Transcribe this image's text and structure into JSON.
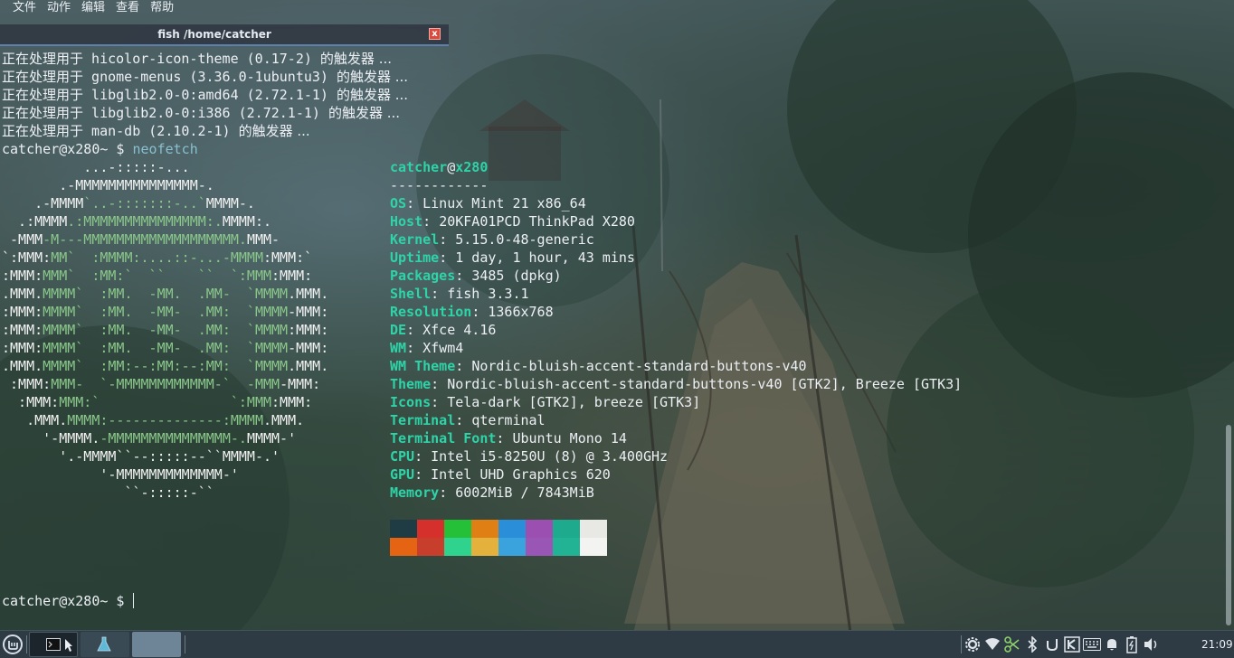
{
  "menubar": {
    "items": [
      "文件",
      "动作",
      "编辑",
      "查看",
      "帮助"
    ]
  },
  "tab": {
    "title": "fish /home/catcher",
    "close_glyph": "x"
  },
  "terminal": {
    "trigger_prefix": "正在处理用于",
    "trigger_suffix": "的触发器 ...",
    "trigger_lines": [
      "hicolor-icon-theme (0.17-2)",
      "gnome-menus (3.36.0-1ubuntu3)",
      "libglib2.0-0:amd64 (2.72.1-1)",
      "libglib2.0-0:i386 (2.72.1-1)",
      "man-db (2.10.2-1)"
    ],
    "prompt": "catcher@x280~ $",
    "command": "neofetch",
    "final_prompt": "catcher@x280~ $"
  },
  "neofetch": {
    "logo": [
      [
        [
          "w",
          "          ...-:::::-..."
        ]
      ],
      [
        [
          "w",
          "       .-MMMMMMMMMMMMMMM-."
        ]
      ],
      [
        [
          "w",
          "    .-MMMM"
        ],
        [
          "g",
          "`..-:::::::-..`"
        ],
        [
          "w",
          "MMMM-."
        ]
      ],
      [
        [
          "w",
          "  .:MMMM"
        ],
        [
          "g",
          ".:MMMMMMMMMMMMMMM:."
        ],
        [
          "w",
          "MMMM:."
        ]
      ],
      [
        [
          "w",
          " -MMM"
        ],
        [
          "g",
          "-M---MMMMMMMMMMMMMMMMMMM."
        ],
        [
          "w",
          "MMM-"
        ]
      ],
      [
        [
          "w",
          "`:MMM:"
        ],
        [
          "g",
          "MM`  :MMMM:....::-...-MMMM"
        ],
        [
          "w",
          ":MMM:`"
        ]
      ],
      [
        [
          "w",
          ":MMM:"
        ],
        [
          "g",
          "MMM`  :MM:`  ``    ``  `:MMM"
        ],
        [
          "w",
          ":MMM:"
        ]
      ],
      [
        [
          "w",
          ".MMM."
        ],
        [
          "g",
          "MMMM`  :MM.  -MM.  .MM-  `MMMM"
        ],
        [
          "w",
          ".MMM."
        ]
      ],
      [
        [
          "w",
          ":MMM:"
        ],
        [
          "g",
          "MMMM`  :MM.  -MM-  .MM:  `MMMM"
        ],
        [
          "w",
          "-MMM:"
        ]
      ],
      [
        [
          "w",
          ":MMM:"
        ],
        [
          "g",
          "MMMM`  :MM.  -MM-  .MM:  `MMMM"
        ],
        [
          "w",
          ":MMM:"
        ]
      ],
      [
        [
          "w",
          ":MMM:"
        ],
        [
          "g",
          "MMMM`  :MM.  -MM-  .MM:  `MMMM"
        ],
        [
          "w",
          "-MMM:"
        ]
      ],
      [
        [
          "w",
          ".MMM."
        ],
        [
          "g",
          "MMMM`  :MM:--:MM:--:MM:  `MMMM"
        ],
        [
          "w",
          ".MMM."
        ]
      ],
      [
        [
          "w",
          " :MMM:"
        ],
        [
          "g",
          "MMM-  `-MMMMMMMMMMMM-`  -MMM"
        ],
        [
          "w",
          "-MMM:"
        ]
      ],
      [
        [
          "w",
          "  :MMM:"
        ],
        [
          "g",
          "MMM:`                `:MMM"
        ],
        [
          "w",
          ":MMM:"
        ]
      ],
      [
        [
          "w",
          "   .MMM."
        ],
        [
          "g",
          "MMMM:--------------:MMMM"
        ],
        [
          "w",
          ".MMM."
        ]
      ],
      [
        [
          "w",
          "     '-MMMM."
        ],
        [
          "g",
          "-MMMMMMMMMMMMMMM-."
        ],
        [
          "w",
          "MMMM-'"
        ]
      ],
      [
        [
          "w",
          "       '.-MMMM``--:::::--``MMMM-.'"
        ]
      ],
      [
        [
          "w",
          "            '-MMMMMMMMMMMMM-'"
        ]
      ],
      [
        [
          "w",
          "               ``-:::::-``"
        ]
      ]
    ],
    "user": "catcher",
    "at": "@",
    "host": "x280",
    "separator": "------------",
    "info": [
      {
        "key": "OS",
        "value": "Linux Mint 21 x86_64"
      },
      {
        "key": "Host",
        "value": "20KFA01PCD ThinkPad X280"
      },
      {
        "key": "Kernel",
        "value": "5.15.0-48-generic"
      },
      {
        "key": "Uptime",
        "value": "1 day, 1 hour, 43 mins"
      },
      {
        "key": "Packages",
        "value": "3485 (dpkg)"
      },
      {
        "key": "Shell",
        "value": "fish 3.3.1"
      },
      {
        "key": "Resolution",
        "value": "1366x768"
      },
      {
        "key": "DE",
        "value": "Xfce 4.16"
      },
      {
        "key": "WM",
        "value": "Xfwm4"
      },
      {
        "key": "WM Theme",
        "value": "Nordic-bluish-accent-standard-buttons-v40"
      },
      {
        "key": "Theme",
        "value": "Nordic-bluish-accent-standard-buttons-v40 [GTK2], Breeze [GTK3]"
      },
      {
        "key": "Icons",
        "value": "Tela-dark [GTK2], breeze [GTK3]"
      },
      {
        "key": "Terminal",
        "value": "qterminal"
      },
      {
        "key": "Terminal Font",
        "value": "Ubuntu Mono 14"
      },
      {
        "key": "CPU",
        "value": "Intel i5-8250U (8) @ 3.400GHz"
      },
      {
        "key": "GPU",
        "value": "Intel UHD Graphics 620"
      },
      {
        "key": "Memory",
        "value": "6002MiB / 7843MiB"
      }
    ],
    "palette_row1": [
      "#1f3c44",
      "#d5302b",
      "#26c038",
      "#e07f14",
      "#2a8fd8",
      "#9b4fb0",
      "#1eaa8c",
      "#e8e8e4"
    ],
    "palette_row2": [
      "#e46414",
      "#c73e2c",
      "#2fd38d",
      "#e5b13d",
      "#3aa3dd",
      "#9a56b4",
      "#22b294",
      "#f3f3f1"
    ]
  },
  "taskbar": {
    "tray_icons": [
      "settings-gear-icon",
      "wifi-icon",
      "scissors-icon",
      "bluetooth-icon",
      "update-icon",
      "kdeconnect-icon",
      "keyboard-icon",
      "notification-bell-icon",
      "battery-icon",
      "volume-icon"
    ],
    "clock": "21:09"
  },
  "colors": {
    "accent": "#5e81ac",
    "prompt_cmd": "#88c0d0",
    "info_key": "#2fd3a8",
    "logo_green": "#8ac78a"
  }
}
